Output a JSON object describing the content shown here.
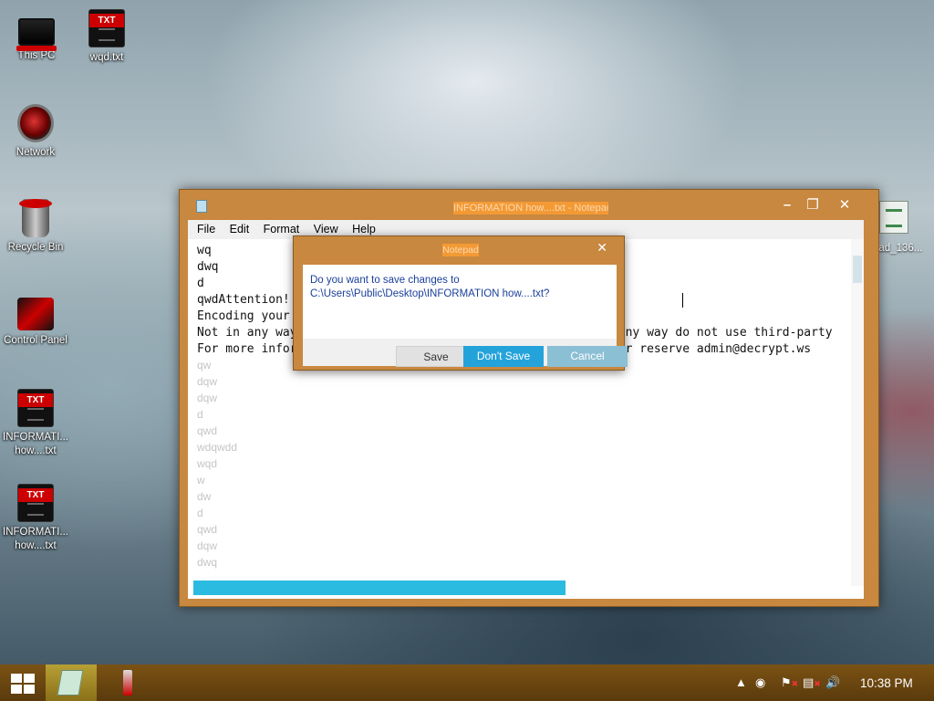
{
  "desktop": {
    "icons": [
      {
        "label": "This PC"
      },
      {
        "label": "wqd.txt"
      },
      {
        "label": "Network"
      },
      {
        "label": "Recycle Bin"
      },
      {
        "label": "Control Panel"
      },
      {
        "label_line1": "INFORMATI...",
        "label_line2": "how....txt"
      },
      {
        "label_line1": "INFORMATI...",
        "label_line2": "how....txt"
      },
      {
        "label": "oad_136..."
      }
    ]
  },
  "notepad": {
    "title": "INFORMATION how....txt - Notepad",
    "menu": [
      "File",
      "Edit",
      "Format",
      "View",
      "Help"
    ],
    "lines": {
      "l1": "wq",
      "l2": "dwq",
      "l3": "d",
      "l4": "qwdAttention!",
      "l5": "Encoding your files!",
      "l6": "Not in any way do not contact slugh intermediaries! Not in any way do not use third-party",
      "l7": "For more information, write to the post decrypt@decrypt.ws or reserve admin@decrypt.ws",
      "faded": [
        "qw",
        "dqw",
        "dqw",
        "d",
        "qwd",
        "wdqwdd",
        "wqd",
        "w",
        "dw",
        "d",
        "qwd",
        "dqw",
        "dwq"
      ]
    }
  },
  "dialog": {
    "title": "Notepad",
    "message_line1": "Do you want to save changes to",
    "message_line2": "C:\\Users\\Public\\Desktop\\INFORMATION how....txt?",
    "save_label": "Save",
    "dont_save_label": "Don't Save",
    "cancel_label": "Cancel"
  },
  "taskbar": {
    "clock": "10:38 PM"
  },
  "colors": {
    "window_frame": "#c8883f",
    "taskbar": "#6a4510",
    "accent_button": "#24a3db"
  }
}
